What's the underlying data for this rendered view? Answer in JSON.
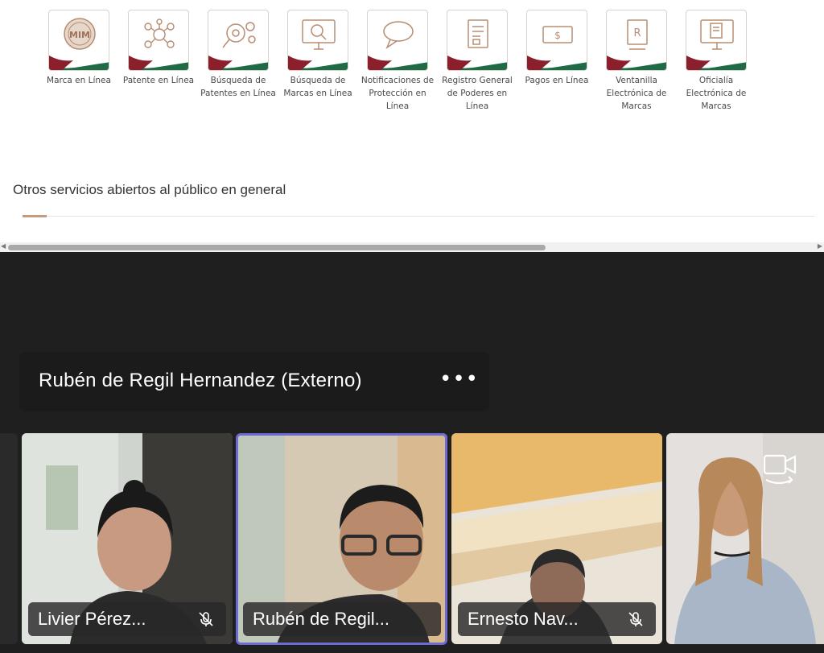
{
  "website": {
    "services": [
      {
        "label": "Marca en Línea",
        "icon": "mark-stamp-icon"
      },
      {
        "label": "Patente en Línea",
        "icon": "molecule-icon"
      },
      {
        "label": "Búsqueda de Patentes en Línea",
        "icon": "magnifier-gears-icon"
      },
      {
        "label": "Búsqueda de Marcas en Línea",
        "icon": "monitor-search-icon"
      },
      {
        "label": "Notificaciones de Protección en Línea",
        "icon": "speech-bubble-icon"
      },
      {
        "label": "Registro General de Poderes en Línea",
        "icon": "document-icon"
      },
      {
        "label": "Pagos en Línea",
        "icon": "money-icon"
      },
      {
        "label": "Ventanilla Electrónica de Marcas",
        "icon": "registered-trademark-icon"
      },
      {
        "label": "Oficialía Electrónica de Marcas",
        "icon": "computer-document-icon"
      }
    ],
    "section_title": "Otros servicios abiertos al público en general"
  },
  "meeting": {
    "pinned_participant": "Rubén de Regil Hernandez (Externo)",
    "more_options": "•••",
    "participants": [
      {
        "name": "Livier Pérez...",
        "muted": true
      },
      {
        "name": "Rubén de Regil...",
        "muted": false,
        "active_speaker": true
      },
      {
        "name": "Ernesto Nav...",
        "muted": true
      },
      {
        "name": "",
        "muted": false
      }
    ]
  },
  "colors": {
    "brand_accent": "#c49a7c",
    "flag_green": "#1e6b45",
    "flag_red": "#8c1f2c",
    "active_speaker_border": "#6b6bd6",
    "meeting_bg": "#1f1f1f"
  }
}
